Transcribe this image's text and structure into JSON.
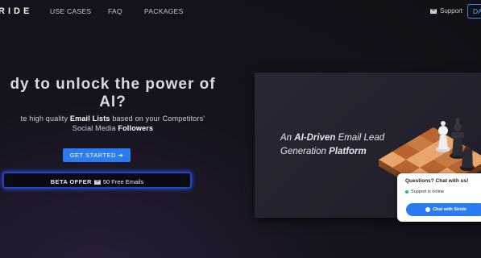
{
  "nav": {
    "logo": "RIDE",
    "links": [
      "USE CASES",
      "FAQ",
      "PACKAGES"
    ],
    "support": "Support",
    "partial_button": "DA"
  },
  "hero": {
    "headline_line1": "dy to unlock the power of",
    "headline_line2": "AI?",
    "sub_pre": "te high quality ",
    "sub_bold1": "Email Lists",
    "sub_mid": " based on your Competitors'",
    "sub_line2_pre": "Social Media ",
    "sub_bold2": "Followers",
    "cta": "GET STARTED ➔",
    "beta_label": "BETA OFFER",
    "beta_text": "50 Free Emails"
  },
  "video": {
    "line_pre": "An ",
    "line_bold1": "AI-Driven",
    "line_mid": " Email Lead Generation ",
    "line_bold2": "Platform"
  },
  "chat": {
    "title": "Questions? Chat with us!",
    "status": "Support is online",
    "button": "Chat with Stride",
    "status_color": "#22c55e"
  },
  "colors": {
    "accent": "#2a7cf0",
    "beta_border": "#1a46c8"
  }
}
